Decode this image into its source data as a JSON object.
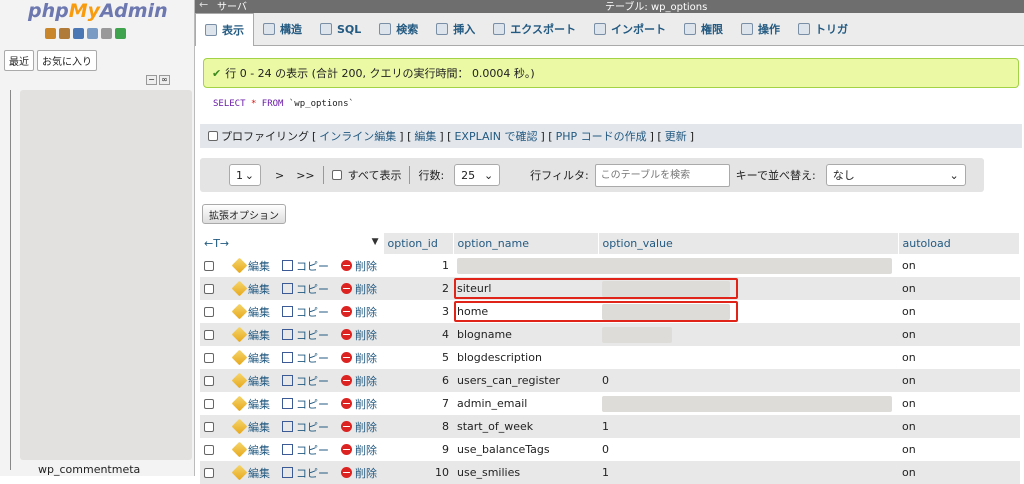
{
  "logo": {
    "php": "php",
    "my": "My",
    "admin": "Admin"
  },
  "left": {
    "tabs": [
      "最近",
      "お気に入り"
    ],
    "bottom_item": "wp_commentmeta"
  },
  "topbar": {
    "back": "←",
    "server": "サーバ",
    "table": "テーブル: wp_options"
  },
  "menu": [
    {
      "label": "表示",
      "active": true,
      "icon": "browse-icon"
    },
    {
      "label": "構造",
      "icon": "structure-icon"
    },
    {
      "label": "SQL",
      "icon": "sql-icon"
    },
    {
      "label": "検索",
      "icon": "search-icon"
    },
    {
      "label": "挿入",
      "icon": "insert-icon"
    },
    {
      "label": "エクスポート",
      "icon": "export-icon"
    },
    {
      "label": "インポート",
      "icon": "import-icon"
    },
    {
      "label": "権限",
      "icon": "privileges-icon"
    },
    {
      "label": "操作",
      "icon": "operations-icon"
    },
    {
      "label": "トリガ",
      "icon": "triggers-icon"
    }
  ],
  "success": {
    "check": "✔",
    "text": "行 0 - 24 の表示 (合計 200, クエリの実行時間： 0.0004 秒。)"
  },
  "sql": {
    "select": "SELECT",
    "star": "*",
    "from": "FROM",
    "table": "`wp_options`"
  },
  "profiling": {
    "label": "プロファイリング",
    "open": "[",
    "sep": "] [",
    "close": "]",
    "links": [
      "インライン編集",
      "編集",
      "EXPLAIN で確認",
      "PHP コードの作成",
      "更新"
    ]
  },
  "nav": {
    "page": "1",
    "next": ">",
    "last": ">>",
    "show_all": "すべて表示",
    "rows_label": "行数:",
    "rows_value": "25",
    "filter_label": "行フィルタ:",
    "filter_placeholder": "このテーブルを検索",
    "sort_label": "キーで並べ替え:",
    "sort_value": "なし"
  },
  "expand_button": "拡張オプション",
  "table": {
    "arrows": "←T→",
    "columns": [
      "option_id",
      "option_name",
      "option_value",
      "autoload"
    ],
    "ops": {
      "edit": "編集",
      "copy": "コピー",
      "delete": "削除"
    },
    "rows": [
      {
        "id": "1",
        "name": "",
        "value": "",
        "autoload": "on"
      },
      {
        "id": "2",
        "name": "siteurl",
        "value": "",
        "autoload": "on"
      },
      {
        "id": "3",
        "name": "home",
        "value": "",
        "autoload": "on"
      },
      {
        "id": "4",
        "name": "blogname",
        "value": "",
        "autoload": "on"
      },
      {
        "id": "5",
        "name": "blogdescription",
        "value": "",
        "autoload": "on"
      },
      {
        "id": "6",
        "name": "users_can_register",
        "value": "0",
        "autoload": "on"
      },
      {
        "id": "7",
        "name": "admin_email",
        "value": "",
        "autoload": "on"
      },
      {
        "id": "8",
        "name": "start_of_week",
        "value": "1",
        "autoload": "on"
      },
      {
        "id": "9",
        "name": "use_balanceTags",
        "value": "0",
        "autoload": "on"
      },
      {
        "id": "10",
        "name": "use_smilies",
        "value": "1",
        "autoload": "on"
      }
    ]
  },
  "colors": {
    "accent": "#235a81",
    "success_bg": "#ebf8a4",
    "highlight": "#e0241a"
  }
}
